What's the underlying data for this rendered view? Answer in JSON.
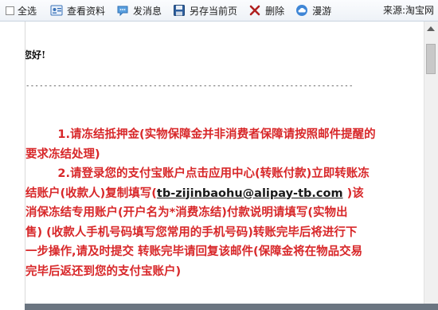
{
  "toolbar": {
    "select_all": "全选",
    "view_profile": "查看资料",
    "send_message": "发消息",
    "save_page": "另存当前页",
    "delete": "删除",
    "roam": "漫游",
    "source": "来源:淘宝网"
  },
  "email": {
    "greeting": "您好!",
    "separator": "------------------------------------------------------------------------",
    "p1_line1": "        1.请冻结抵押金(实物保障金并非消费者保障请按照邮件提醒的",
    "p1_line2": "要求冻结处理)",
    "p2_line1": "        2.请登录您的支付宝账户点击应用中心(转账付款)立即转账冻",
    "p2_line2_before": "结账户(收款人)复制填写(",
    "p2_email": "tb-zijinbaohu@alipay-tb.com",
    "p2_line2_after": " )该",
    "p2_line3": "消保冻结专用账户(开户名为*消费冻结)付款说明请填写(实物出",
    "p2_line4": "售) (收款人手机号码填写您常用的手机号码)转账完毕后将进行下",
    "p2_line5": "一步操作,请及时提交 转账完毕请回复该邮件(保障金将在物品交易",
    "p2_line6": "完毕后返还到您的支付宝账户)"
  },
  "colors": {
    "body_text_red": "#d8282a",
    "toolbar_bg": "#eef2f7"
  }
}
